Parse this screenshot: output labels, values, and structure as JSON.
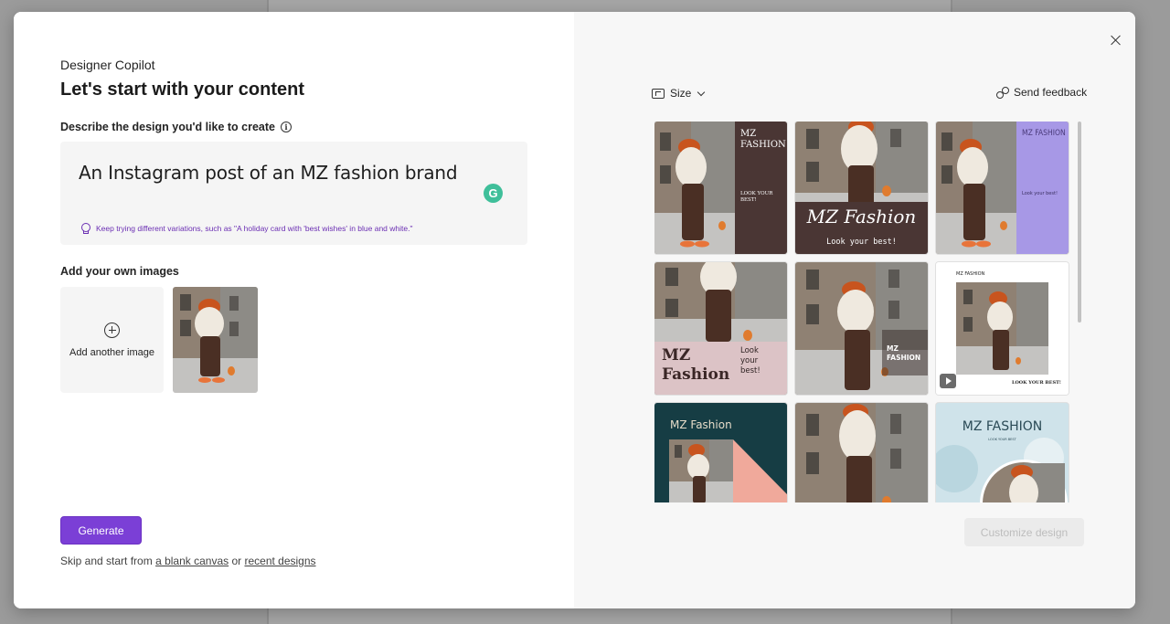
{
  "dialog": {
    "eyebrow": "Designer Copilot",
    "title": "Let's start with your content",
    "describe_label": "Describe the design you'd like to create",
    "prompt_text": "An Instagram post of an MZ fashion brand",
    "grammarly_letter": "G",
    "tip": "Keep trying different variations, such as \"A holiday card with 'best wishes' in blue and white.\"",
    "images_label": "Add your own images",
    "add_image_label": "Add another image",
    "generate_label": "Generate",
    "skip_prefix": "Skip and start from",
    "skip_link_blank": "a blank canvas",
    "skip_or": "or",
    "skip_link_recent": "recent designs"
  },
  "toolbar": {
    "size_label": "Size",
    "feedback_label": "Send feedback"
  },
  "customize_label": "Customize design",
  "colors": {
    "accent": "#7b3fd6",
    "tip_text": "#6b2fb3",
    "grammarly": "#3fbf9a"
  },
  "designs": [
    {
      "brand": "MZ\nFASHION",
      "tagline": "LOOK YOUR\nBEST!"
    },
    {
      "brand": "MZ Fashion",
      "tagline": "Look your best!"
    },
    {
      "brand": "MZ FASHION",
      "tagline": "Look your best!"
    },
    {
      "brand": "MZ\nFashion",
      "tagline": "Look\nyour\nbest!"
    },
    {
      "brand": "MZ\nFASHION",
      "tagline": ""
    },
    {
      "brand": "MZ FASHION",
      "tagline": "LOOK YOUR BEST!"
    },
    {
      "brand": "MZ Fashion",
      "tagline": ""
    },
    {
      "brand": "",
      "tagline": ""
    },
    {
      "brand": "MZ FASHION",
      "tagline": "LOOK YOUR BEST"
    }
  ]
}
